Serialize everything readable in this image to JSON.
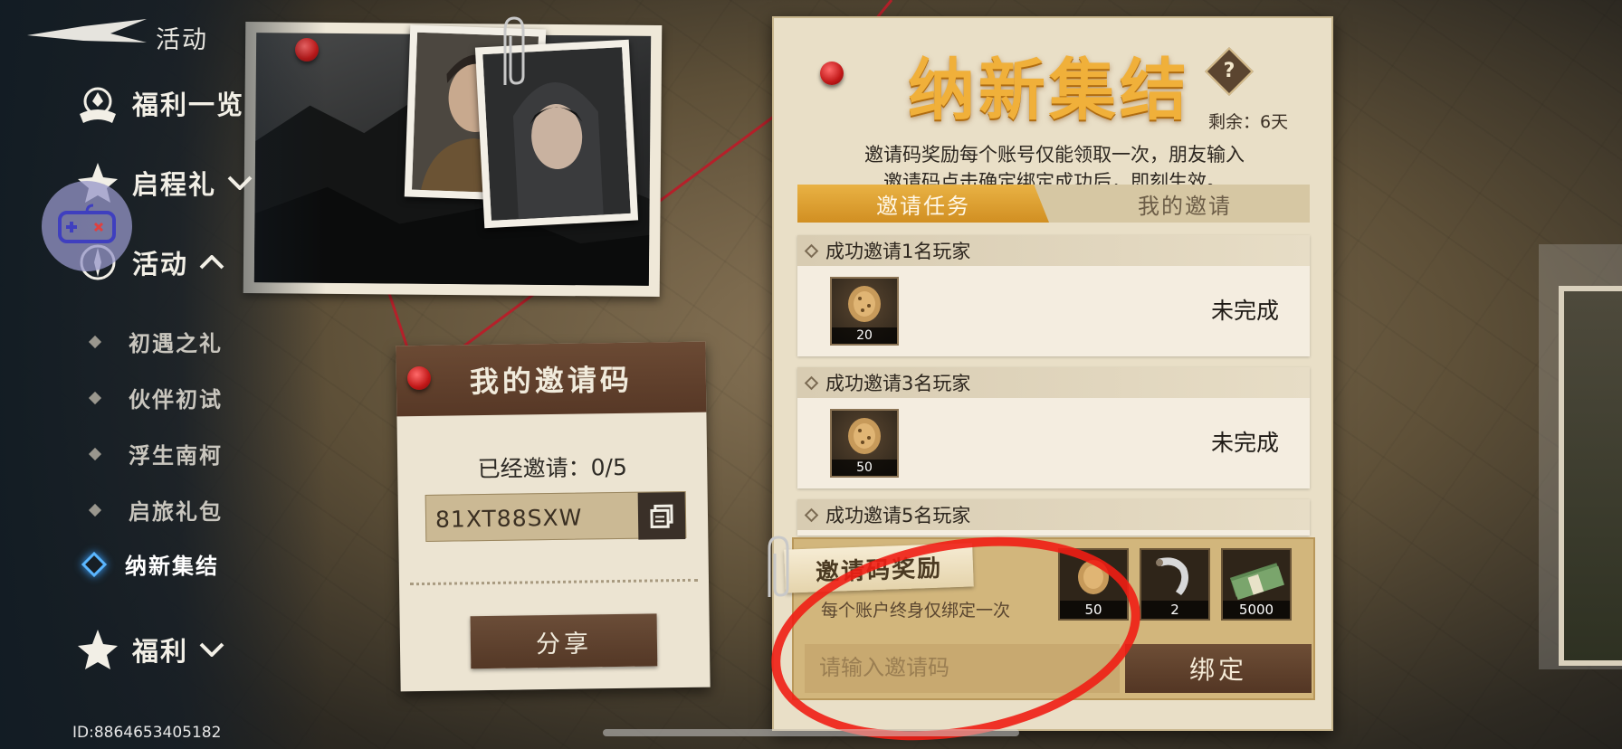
{
  "sidebar": {
    "back_label": "活动",
    "menu": [
      {
        "label": "福利一览"
      },
      {
        "label": "启程礼"
      },
      {
        "label": "活动"
      },
      {
        "label": "福利"
      }
    ],
    "sub_items": [
      {
        "label": "初遇之礼"
      },
      {
        "label": "伙伴初试"
      },
      {
        "label": "浮生南柯"
      },
      {
        "label": "启旅礼包"
      },
      {
        "label": "纳新集结"
      }
    ],
    "active_sub_item": "纳新集结",
    "user_id": "ID:8864653405182"
  },
  "invite_card": {
    "title": "我的邀请码",
    "invited_text": "已经邀请：0/5",
    "code": "81XT88SXW",
    "share_label": "分享"
  },
  "panel": {
    "title": "纳新集结",
    "help": "?",
    "remaining": "剩余：6天",
    "description_line1": "邀请码奖励每个账号仅能领取一次，朋友输入",
    "description_line2": "邀请码点击确定绑定成功后，即刻生效。",
    "tabs": {
      "active": "邀请任务",
      "inactive": "我的邀请"
    },
    "tasks": [
      {
        "title": "成功邀请1名玩家",
        "reward_count": "20",
        "status": "未完成"
      },
      {
        "title": "成功邀请3名玩家",
        "reward_count": "50",
        "status": "未完成"
      },
      {
        "title": "成功邀请5名玩家"
      }
    ],
    "code_reward": {
      "label": "邀请码奖励",
      "note": "每个账户终身仅绑定一次",
      "items": [
        {
          "icon": "nut-icon",
          "count": "50"
        },
        {
          "icon": "blade-icon",
          "count": "2"
        },
        {
          "icon": "cash-icon",
          "count": "5000"
        }
      ],
      "input_placeholder": "请输入邀请码",
      "bind_label": "绑定"
    }
  },
  "colors": {
    "title_gold": "#f0b03a",
    "tab_active": "#d9992a",
    "button_brown": "#5e412c",
    "annotation_red": "#f01e14"
  }
}
